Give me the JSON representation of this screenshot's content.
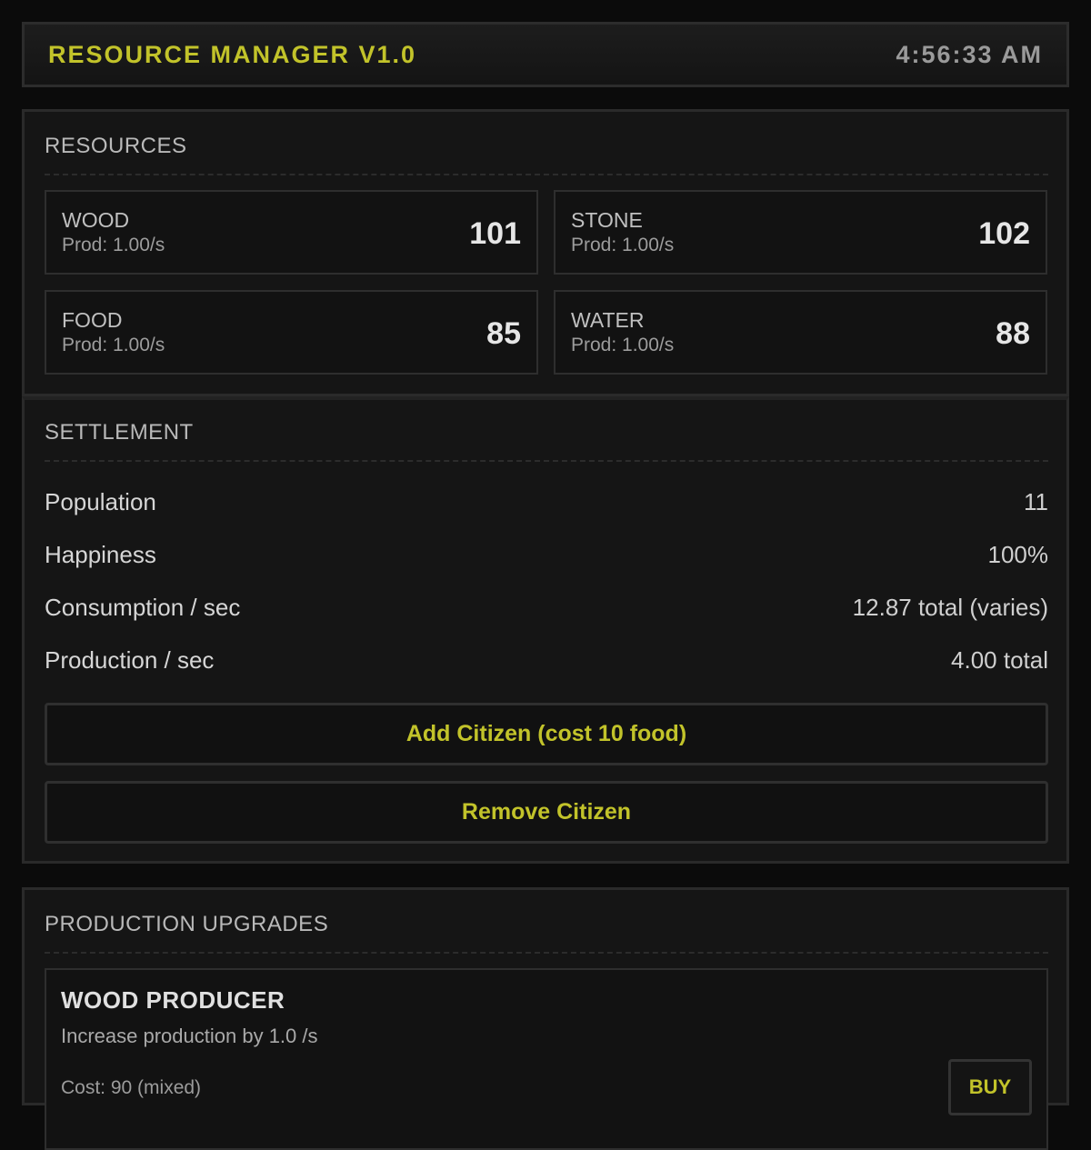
{
  "header": {
    "title": "RESOURCE MANAGER V1.0",
    "clock": "4:56:33 AM"
  },
  "resources": {
    "title": "RESOURCES",
    "items": [
      {
        "name": "WOOD",
        "prod": "Prod: 1.00/s",
        "value": "101"
      },
      {
        "name": "STONE",
        "prod": "Prod: 1.00/s",
        "value": "102"
      },
      {
        "name": "FOOD",
        "prod": "Prod: 1.00/s",
        "value": "85"
      },
      {
        "name": "WATER",
        "prod": "Prod: 1.00/s",
        "value": "88"
      }
    ]
  },
  "settlement": {
    "title": "SETTLEMENT",
    "stats": [
      {
        "label": "Population",
        "value": "11"
      },
      {
        "label": "Happiness",
        "value": "100%"
      },
      {
        "label": "Consumption / sec",
        "value": "12.87 total (varies)"
      },
      {
        "label": "Production / sec",
        "value": "4.00 total"
      }
    ],
    "add_label": "Add Citizen (cost 10 food)",
    "remove_label": "Remove Citizen"
  },
  "upgrades": {
    "title": "PRODUCTION UPGRADES",
    "items": [
      {
        "name": "WOOD PRODUCER",
        "description": "Increase production by 1.0 /s",
        "cost": "Cost: 90 (mixed)",
        "buy_label": "BUY"
      }
    ]
  }
}
